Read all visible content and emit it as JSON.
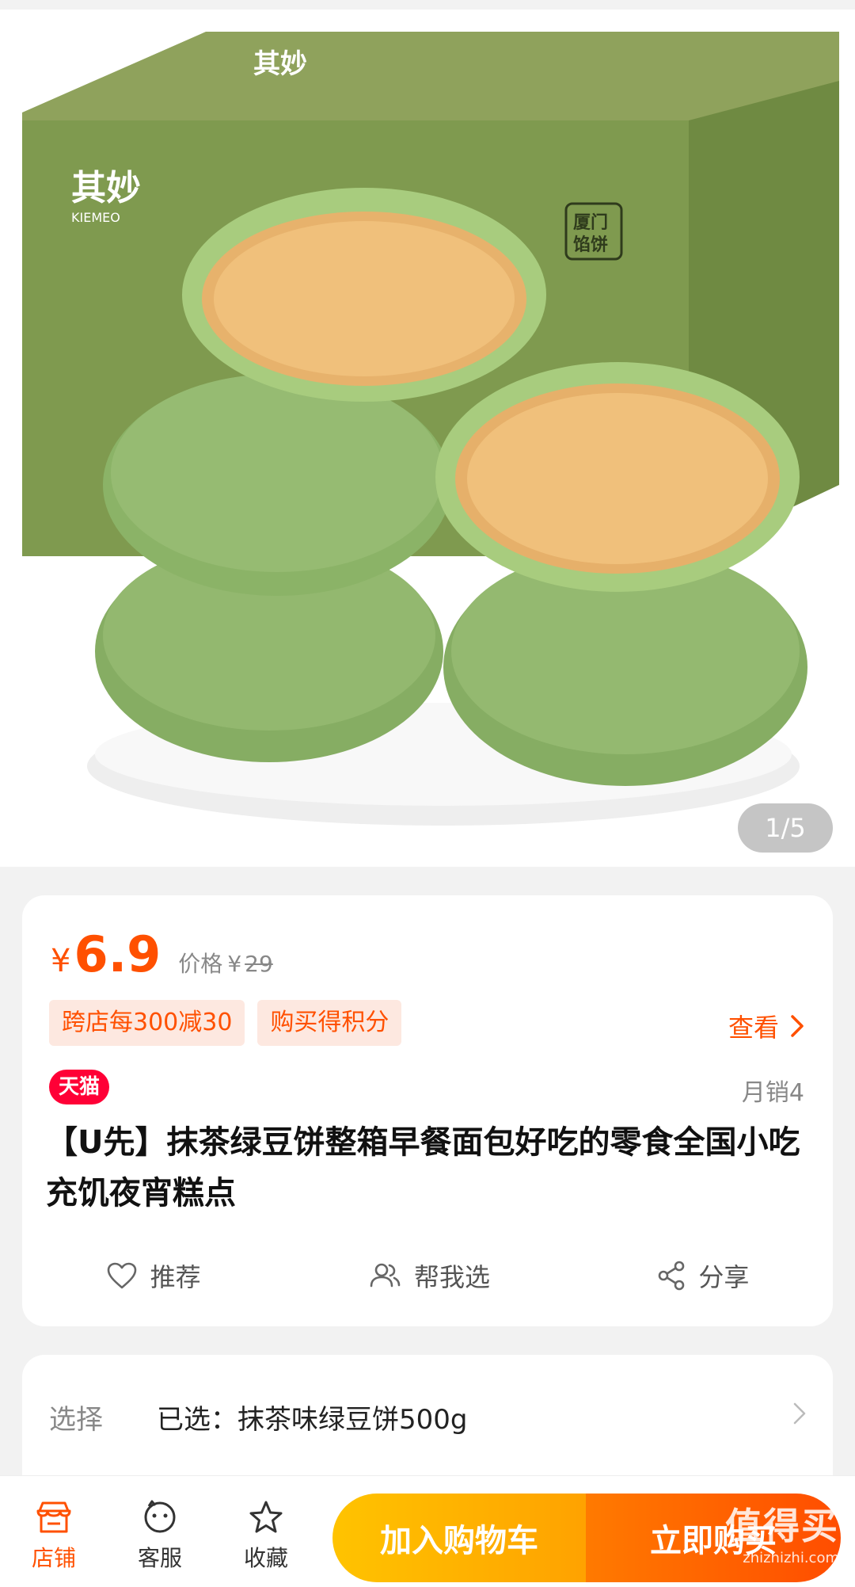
{
  "gallery": {
    "counter": "1/5"
  },
  "product": {
    "price_symbol": "¥",
    "price": "6.9",
    "orig_label": "价格",
    "orig_symbol": "¥",
    "orig_price": "29",
    "promos": [
      "跨店每300减30",
      "购买得积分"
    ],
    "view_label": "查看",
    "store_badge": "天猫",
    "sales": "月销4",
    "title": "【U先】抹茶绿豆饼整箱早餐面包好吃的零食全国小吃充饥夜宵糕点"
  },
  "actions": {
    "recommend": "推荐",
    "help_choose": "帮我选",
    "share": "分享"
  },
  "selection": {
    "label": "选择",
    "value": "已选：抹茶味绿豆饼500g"
  },
  "bottom": {
    "shop": "店铺",
    "service": "客服",
    "favorite": "收藏",
    "add_to_cart": "加入购物车",
    "buy_now": "立即购买"
  },
  "watermark": {
    "big": "值得买",
    "small": "zhizhizhi.com"
  },
  "colors": {
    "accent": "#ff5000",
    "tmall": "#ff0036",
    "cart": "#ffb000"
  }
}
